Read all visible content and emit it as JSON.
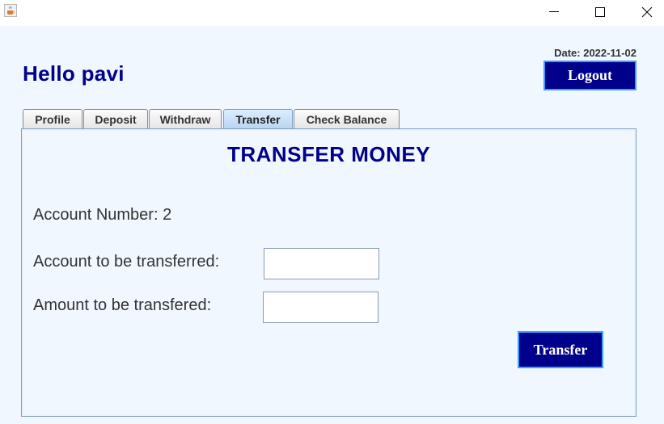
{
  "window": {
    "icon": "java-cup-icon",
    "controls": [
      "minimize-icon",
      "maximize-icon",
      "close-icon"
    ]
  },
  "header": {
    "greeting": "Hello pavi",
    "date": "Date: 2022-11-02",
    "logout_label": "Logout"
  },
  "tabs": [
    {
      "label": "Profile",
      "active": false
    },
    {
      "label": "Deposit",
      "active": false
    },
    {
      "label": "Withdraw",
      "active": false
    },
    {
      "label": "Transfer",
      "active": true
    },
    {
      "label": "Check Balance",
      "active": false
    }
  ],
  "transfer": {
    "title": "TRANSFER MONEY",
    "account_number": "Account Number: 2",
    "to_account_label": "Account to be transferred:",
    "to_account_value": "",
    "amount_label": "Amount to be transfered:",
    "amount_value": "",
    "submit_label": "Transfer"
  },
  "colors": {
    "accent": "#00008b",
    "button_border": "#3aa0ff",
    "background": "#f0f7ff"
  }
}
